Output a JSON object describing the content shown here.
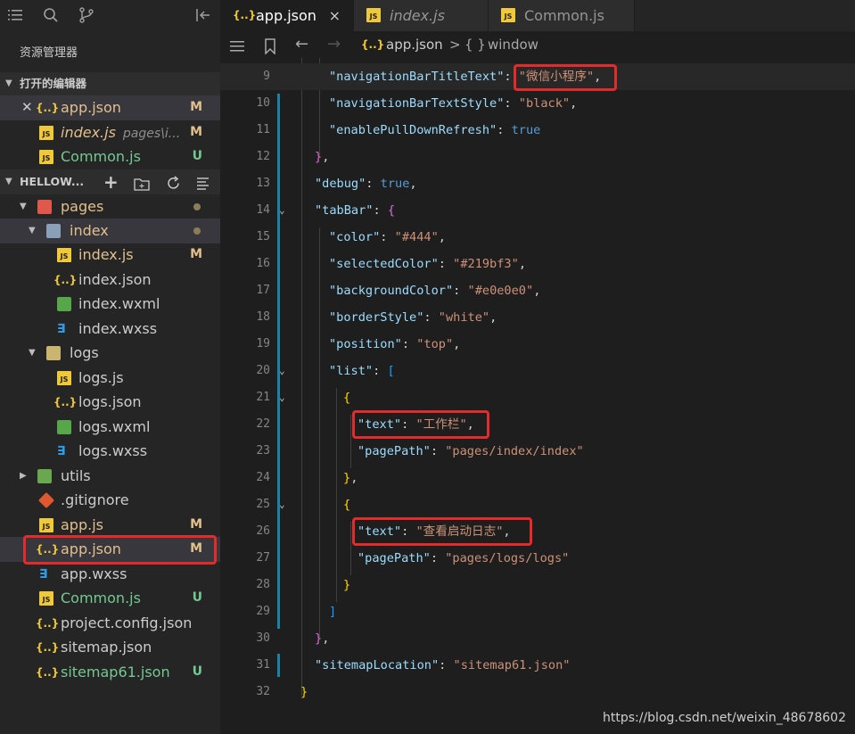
{
  "sidebar": {
    "title": "资源管理器",
    "open_editors_title": "打开的编辑器",
    "open_editors": [
      {
        "label": "app.json",
        "badge": "M"
      },
      {
        "label": "index.js",
        "desc": "pages\\i...",
        "badge": "M"
      },
      {
        "label": "Common.js",
        "badge": "U"
      }
    ],
    "workspace_title": "HELLOW...",
    "tree": [
      {
        "label": "pages"
      },
      {
        "label": "index"
      },
      {
        "label": "index.js",
        "badge": "M"
      },
      {
        "label": "index.json"
      },
      {
        "label": "index.wxml"
      },
      {
        "label": "index.wxss"
      },
      {
        "label": "logs"
      },
      {
        "label": "logs.js"
      },
      {
        "label": "logs.json"
      },
      {
        "label": "logs.wxml"
      },
      {
        "label": "logs.wxss"
      },
      {
        "label": "utils"
      },
      {
        "label": ".gitignore"
      },
      {
        "label": "app.js",
        "badge": "M"
      },
      {
        "label": "app.json",
        "badge": "M"
      },
      {
        "label": "app.wxss"
      },
      {
        "label": "Common.js",
        "badge": "U"
      },
      {
        "label": "project.config.json"
      },
      {
        "label": "sitemap.json"
      },
      {
        "label": "sitemap61.json",
        "badge": "U"
      }
    ]
  },
  "tabs": [
    {
      "label": "app.json",
      "close": "×"
    },
    {
      "label": "index.js"
    },
    {
      "label": "Common.js"
    }
  ],
  "breadcrumb": {
    "file": "app.json",
    "sep": ">",
    "symbol": "window"
  },
  "editor": {
    "line_numbers": [
      "9",
      "10",
      "11",
      "12",
      "13",
      "14",
      "15",
      "16",
      "17",
      "18",
      "19",
      "20",
      "21",
      "22",
      "23",
      "24",
      "25",
      "26",
      "27",
      "28",
      "29",
      "30",
      "31",
      "32"
    ],
    "lines": {
      "l9": {
        "key": "\"navigationBarTitleText\"",
        "val": "\"微信小程序\""
      },
      "l10": {
        "key": "\"navigationBarTextStyle\"",
        "val": "\"black\""
      },
      "l11": {
        "key": "\"enablePullDownRefresh\"",
        "val": "true"
      },
      "l13": {
        "key": "\"debug\"",
        "val": "true"
      },
      "l14": {
        "key": "\"tabBar\""
      },
      "l15": {
        "key": "\"color\"",
        "val": "\"#444\""
      },
      "l16": {
        "key": "\"selectedColor\"",
        "val": "\"#219bf3\""
      },
      "l17": {
        "key": "\"backgroundColor\"",
        "val": "\"#e0e0e0\""
      },
      "l18": {
        "key": "\"borderStyle\"",
        "val": "\"white\""
      },
      "l19": {
        "key": "\"position\"",
        "val": "\"top\""
      },
      "l20": {
        "key": "\"list\""
      },
      "l22": {
        "key": "\"text\"",
        "val": "\"工作栏\""
      },
      "l23": {
        "key": "\"pagePath\"",
        "val": "\"pages/index/index\""
      },
      "l26": {
        "key": "\"text\"",
        "val": "\"查看启动日志\""
      },
      "l27": {
        "key": "\"pagePath\"",
        "val": "\"pages/logs/logs\""
      },
      "l31": {
        "key": "\"sitemapLocation\"",
        "val": "\"sitemap61.json\""
      }
    }
  },
  "watermark": "https://blog.csdn.net/weixin_48678602",
  "colors": {
    "highlight_box": "#e32b2b",
    "modified": "#e2c08d",
    "untracked": "#73c991",
    "accent_bar": "#1b81a8"
  }
}
